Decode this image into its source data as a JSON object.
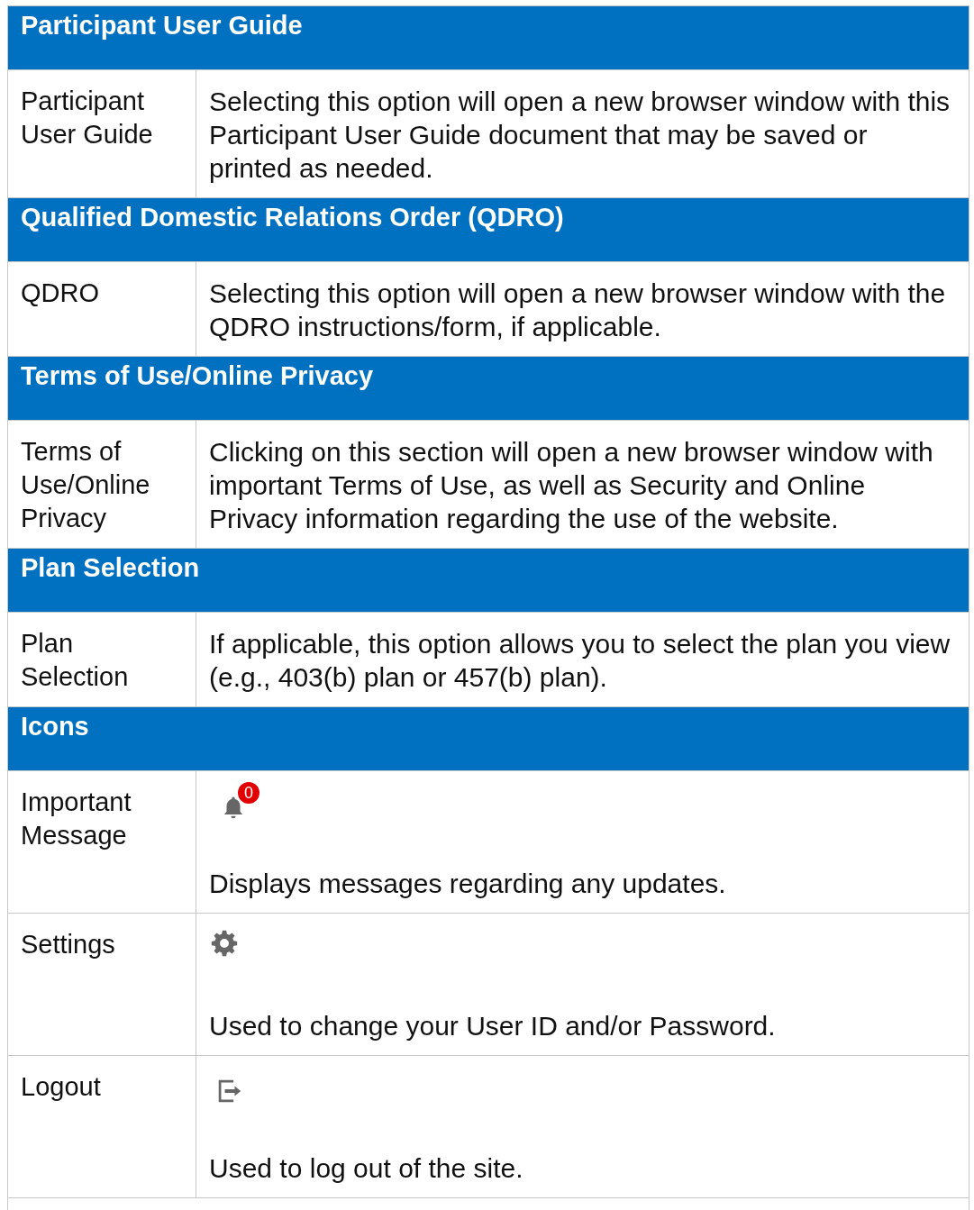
{
  "sections": [
    {
      "heading": "Participant User Guide",
      "rows": [
        {
          "label": "Participant User Guide",
          "description": "Selecting this option will open a new browser window with this Participant User Guide document that may be saved or printed as needed."
        }
      ]
    },
    {
      "heading": "Qualified Domestic Relations Order (QDRO)",
      "rows": [
        {
          "label": "QDRO",
          "description": "Selecting this option will open a new browser window with the QDRO instructions/form, if applicable."
        }
      ]
    },
    {
      "heading": "Terms of Use/Online Privacy",
      "rows": [
        {
          "label": "Terms of Use/Online Privacy",
          "description": "Clicking on this section will open a new browser window with important Terms of Use, as well as Security and Online Privacy information regarding the use of the website."
        }
      ]
    },
    {
      "heading": "Plan Selection",
      "rows": [
        {
          "label": "Plan Selection",
          "description": "If applicable, this option allows you to select the plan you view (e.g., 403(b) plan or 457(b) plan)."
        }
      ]
    },
    {
      "heading": "Icons",
      "rows": [
        {
          "label": "Important Message",
          "kind": "bell",
          "badge": "0",
          "description": "Displays messages regarding any updates."
        },
        {
          "label": "Settings",
          "kind": "gear",
          "description": "Used to change your User ID and/or Password."
        },
        {
          "label": "Logout",
          "kind": "logout",
          "description": "Used to log out of the site."
        }
      ]
    }
  ]
}
